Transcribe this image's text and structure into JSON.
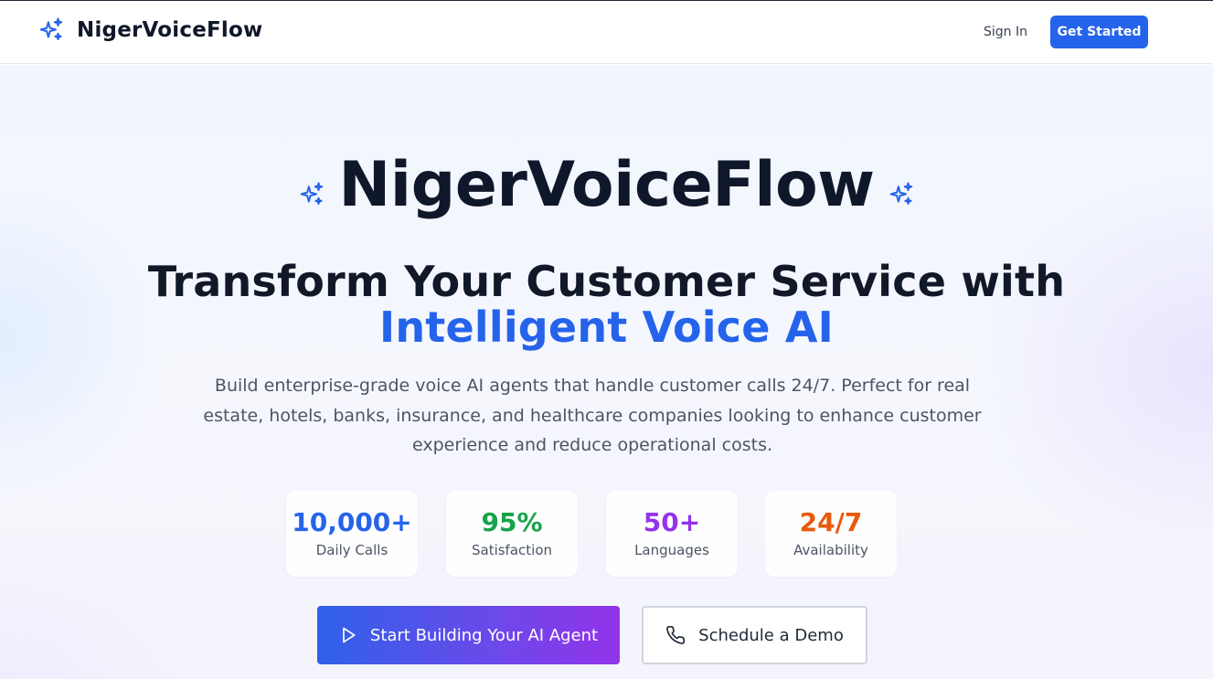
{
  "nav": {
    "brand_name": "NigerVoiceFlow",
    "brand_icon": "sparkles-icon",
    "sign_in_label": "Sign In",
    "get_started_label": "Get Started"
  },
  "hero": {
    "title": "NigerVoiceFlow",
    "headline_line1": "Transform Your Customer Service with",
    "headline_line2": "Intelligent Voice AI",
    "description": "Build enterprise-grade voice AI agents that handle customer calls 24/7. Perfect for real estate, hotels, banks, insurance, and healthcare companies looking to enhance customer experience and reduce operational costs.",
    "stats": [
      {
        "value": "10,000+",
        "label": "Daily Calls",
        "color": "#2563eb"
      },
      {
        "value": "95%",
        "label": "Satisfaction",
        "color": "#16a34a"
      },
      {
        "value": "50+",
        "label": "Languages",
        "color": "#9333ea"
      },
      {
        "value": "24/7",
        "label": "Availability",
        "color": "#ea580c"
      }
    ],
    "primary_cta_label": "Start Building Your AI Agent",
    "primary_cta_icon": "play-icon",
    "secondary_cta_label": "Schedule a Demo",
    "secondary_cta_icon": "phone-icon"
  },
  "colors": {
    "brand_blue": "#2563eb",
    "text_dark": "#0f172a",
    "gradient_end_purple": "#9333ea"
  }
}
